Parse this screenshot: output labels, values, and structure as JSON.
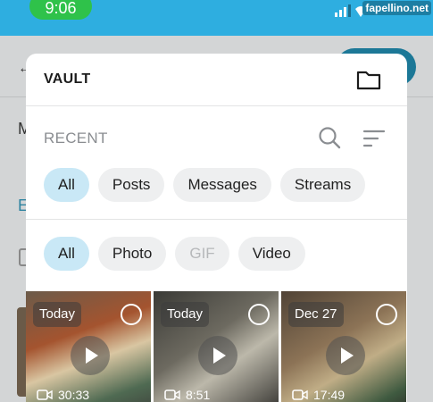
{
  "status_bar": {
    "time": "9:06",
    "watermark": "fapellino.net"
  },
  "modal": {
    "title": "VAULT",
    "folder_icon": "folder-icon",
    "recent_label": "RECENT",
    "search_icon": "search-icon",
    "sort_icon": "sort-icon",
    "source_filters": [
      {
        "label": "All",
        "active": true
      },
      {
        "label": "Posts",
        "active": false
      },
      {
        "label": "Messages",
        "active": false
      },
      {
        "label": "Streams",
        "active": false
      }
    ],
    "type_filters": [
      {
        "label": "All",
        "active": true
      },
      {
        "label": "Photo",
        "active": false
      },
      {
        "label": "GIF",
        "active": false,
        "disabled": true
      },
      {
        "label": "Video",
        "active": false
      }
    ],
    "media": [
      {
        "date": "Today",
        "duration": "30:33"
      },
      {
        "date": "Today",
        "duration": "8:51"
      },
      {
        "date": "Dec 27",
        "duration": "17:49"
      }
    ]
  },
  "colors": {
    "accent": "#2eaee0",
    "chip_active": "#c9e8f6",
    "chip": "#eeeff0"
  }
}
